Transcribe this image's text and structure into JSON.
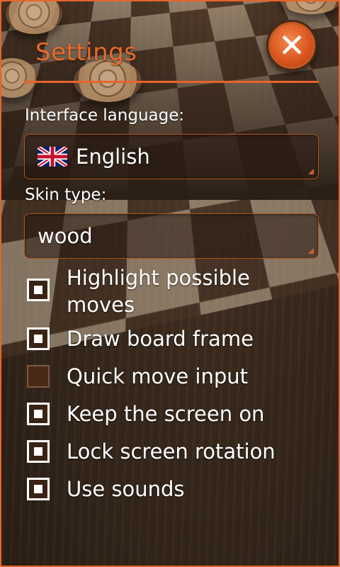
{
  "header": {
    "title": "Settings",
    "close_icon": "close-icon"
  },
  "accent_color": "#e8642a",
  "language": {
    "label": "Interface language:",
    "value": "English",
    "flag_icon": "uk-flag-icon"
  },
  "skin": {
    "label": "Skin type:",
    "value": "wood"
  },
  "options": [
    {
      "label": "Highlight possible moves",
      "checked": true
    },
    {
      "label": "Draw board frame",
      "checked": true
    },
    {
      "label": "Quick move input",
      "checked": false
    },
    {
      "label": "Keep the screen on",
      "checked": true
    },
    {
      "label": "Lock screen rotation",
      "checked": true
    },
    {
      "label": "Use sounds",
      "checked": true
    }
  ]
}
